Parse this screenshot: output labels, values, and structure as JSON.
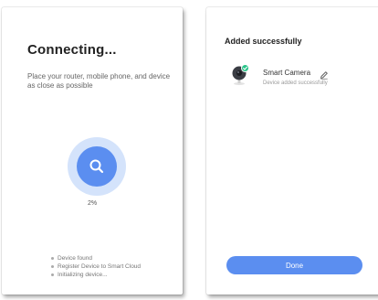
{
  "connecting": {
    "title": "Connecting...",
    "description": "Place your router, mobile phone, and device as close as possible",
    "progress": "2%",
    "steps": [
      "Device found",
      "Register Device to Smart Cloud",
      "Initializing device..."
    ],
    "icon": "search-icon",
    "accent_color": "#5b8ef0"
  },
  "added": {
    "title": "Added successfully",
    "device_name": "Smart Camera",
    "device_status": "Device added successfully",
    "done_label": "Done",
    "icons": [
      "camera-icon",
      "check-badge-icon",
      "edit-icon"
    ],
    "success_color": "#2bc48a"
  }
}
